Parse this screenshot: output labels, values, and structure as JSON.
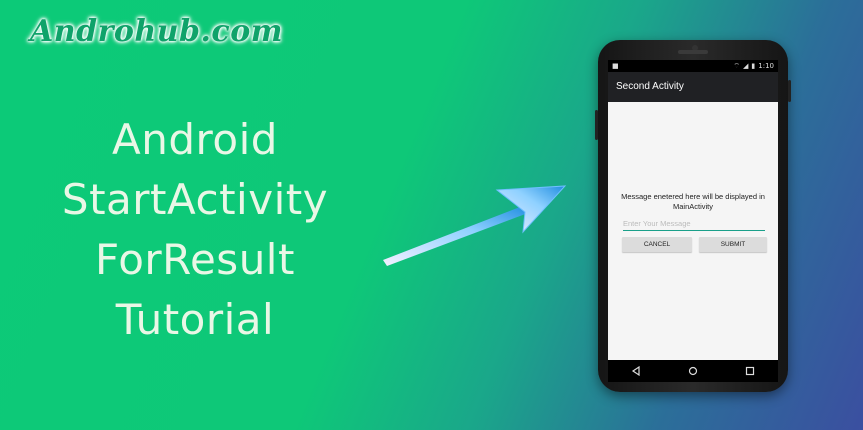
{
  "logo": {
    "text": "Androhub.com"
  },
  "headline": {
    "lines": [
      "Android",
      "StartActivity",
      "ForResult",
      "Tutorial"
    ]
  },
  "phone": {
    "status_time": "1:10",
    "app_title": "Second Activity",
    "message": "Message enetered here will be displayed in MainActivity",
    "input_placeholder": "Enter Your Message",
    "cancel_label": "CANCEL",
    "submit_label": "SUBMIT",
    "nav_icons": [
      "back-icon",
      "home-icon",
      "recents-icon"
    ]
  },
  "colors": {
    "background_start": "#0cca78",
    "background_end": "#3b4fa0",
    "accent": "#1aa08a",
    "app_bar": "#202124"
  }
}
